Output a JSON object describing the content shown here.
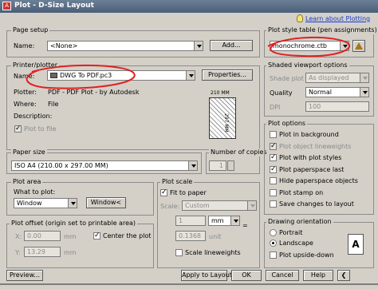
{
  "window": {
    "title": "Plot - D-Size Layout",
    "help_link": "Learn about Plotting"
  },
  "page_setup": {
    "legend": "Page setup",
    "name_label": "Name:",
    "name_value": "<None>",
    "add_button": "Add..."
  },
  "printer": {
    "legend": "Printer/plotter",
    "name_label": "Name:",
    "name_value": "DWG To PDF.pc3",
    "properties_button": "Properties...",
    "plotter_label": "Plotter:",
    "plotter_value": "PDF - PDF Plot - by Autodesk",
    "where_label": "Where:",
    "where_value": "File",
    "description_label": "Description:",
    "plot_to_file": "Plot to file",
    "preview_dim_w": "210 MM",
    "preview_dim_h": "297 MM"
  },
  "paper_size": {
    "legend": "Paper size",
    "value": "ISO A4 (210.00 x 297.00 MM)"
  },
  "copies": {
    "legend": "Number of copies",
    "value": "1"
  },
  "plot_area": {
    "legend": "Plot area",
    "what_label": "What to plot:",
    "what_value": "Window",
    "window_button": "Window<"
  },
  "plot_offset": {
    "legend": "Plot offset (origin set to printable area)",
    "x_label": "X:",
    "x_value": "0.00",
    "x_unit": "mm",
    "y_label": "Y:",
    "y_value": "13.29",
    "y_unit": "mm",
    "center_label": "Center the plot"
  },
  "plot_scale": {
    "legend": "Plot scale",
    "fit_label": "Fit to paper",
    "scale_label": "Scale:",
    "scale_value": "Custom",
    "num_value": "1",
    "unit_value": "mm",
    "den_value": "0.1368",
    "den_unit": "unit",
    "lineweights_label": "Scale lineweights"
  },
  "style_table": {
    "legend": "Plot style table (pen assignments)",
    "value": "monochrome.ctb"
  },
  "shaded": {
    "legend": "Shaded viewport options",
    "shade_label": "Shade plot",
    "shade_value": "As displayed",
    "quality_label": "Quality",
    "quality_value": "Normal",
    "dpi_label": "DPI",
    "dpi_value": "100"
  },
  "plot_options": {
    "legend": "Plot options",
    "items": [
      {
        "label": "Plot in background",
        "checked": false,
        "disabled": false
      },
      {
        "label": "Plot object lineweights",
        "checked": true,
        "disabled": true
      },
      {
        "label": "Plot with plot styles",
        "checked": true,
        "disabled": false
      },
      {
        "label": "Plot paperspace last",
        "checked": true,
        "disabled": false
      },
      {
        "label": "Hide paperspace objects",
        "checked": false,
        "disabled": false
      },
      {
        "label": "Plot stamp on",
        "checked": false,
        "disabled": false
      },
      {
        "label": "Save changes to layout",
        "checked": false,
        "disabled": false
      }
    ]
  },
  "orientation": {
    "legend": "Drawing orientation",
    "portrait": "Portrait",
    "landscape": "Landscape",
    "upside_down": "Plot upside-down",
    "selected": "Landscape",
    "orient_icon_letter": "A"
  },
  "footer": {
    "preview": "Preview...",
    "apply": "Apply to Layout",
    "ok": "OK",
    "cancel": "Cancel",
    "help": "Help"
  },
  "colors": {
    "annotation_red": "#e02020",
    "link_blue": "#1a3dc8"
  }
}
